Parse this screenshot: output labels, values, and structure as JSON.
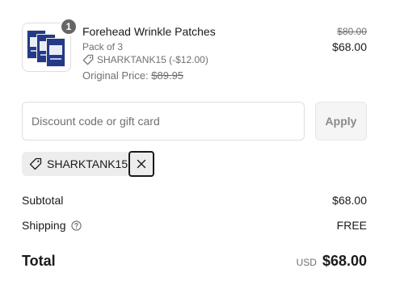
{
  "line_item": {
    "quantity_badge": "1",
    "name": "Forehead Wrinkle Patches",
    "variant": "Pack of 3",
    "discount_applied": "SHARKTANK15 (-$12.00)",
    "original_price_label": "Original Price:",
    "original_price_value": "$89.95",
    "compare_at_price": "$80.00",
    "price": "$68.00",
    "image_icon": "product-packs-image"
  },
  "discount_form": {
    "placeholder": "Discount code or gift card",
    "value": "",
    "apply_label": "Apply"
  },
  "applied_code": {
    "code": "SHARKTANK15",
    "tag_icon": "tag-icon",
    "remove_icon": "close-icon"
  },
  "summary": {
    "subtotal_label": "Subtotal",
    "subtotal_value": "$68.00",
    "shipping_label": "Shipping",
    "shipping_help_icon": "help-circle-icon",
    "shipping_value": "FREE",
    "total_label": "Total",
    "total_currency": "USD",
    "total_value": "$68.00"
  },
  "colors": {
    "text": "#1a1a1a",
    "muted": "#707070",
    "border": "#dedede",
    "product_blue": "#253a86"
  }
}
